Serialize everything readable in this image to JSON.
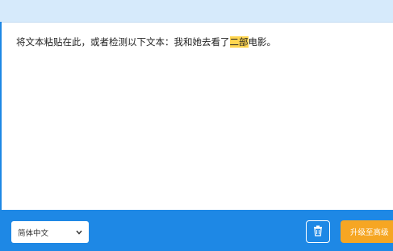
{
  "editor": {
    "text_prefix": "将文本粘贴在此，或者检测以下文本：我和她去看了",
    "highlighted_word": "二部",
    "text_suffix": "电影。"
  },
  "footer": {
    "language_selected": "简体中文",
    "upgrade_label": "升级至高级"
  },
  "colors": {
    "toolbar_blue": "#1e88e5",
    "header_light_blue": "#d6eafb",
    "highlight": "#ffd54f",
    "upgrade_orange": "#f6a623"
  },
  "icons": {
    "language_dropdown": "chevron-down-icon",
    "clear": "trash-icon"
  }
}
